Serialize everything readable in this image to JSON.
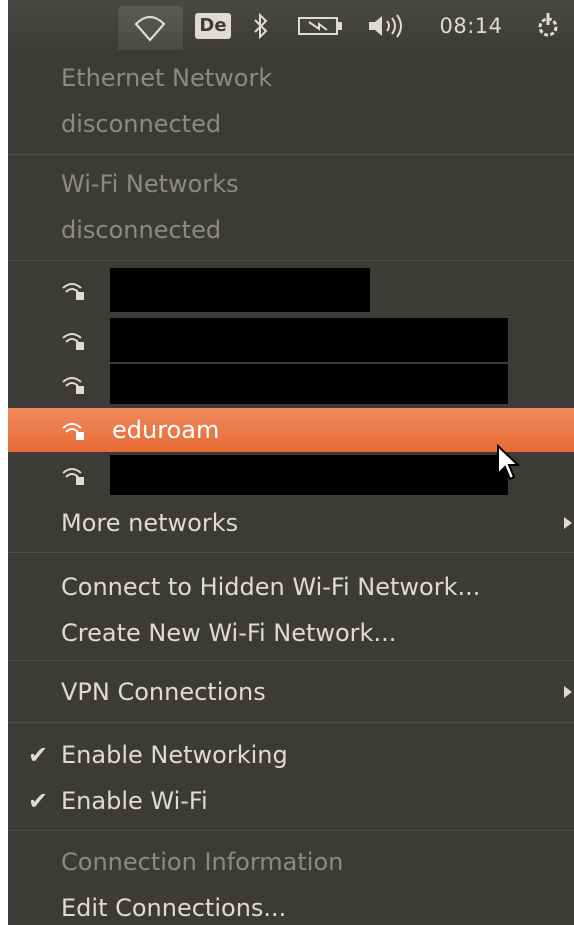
{
  "topbar": {
    "keyboard_layout": "De",
    "time": "08:14",
    "icons": [
      "wifi-icon",
      "bluetooth-icon",
      "battery-charging-icon",
      "volume-icon",
      "power-gear-icon"
    ]
  },
  "menu": {
    "ethernet_header": "Ethernet Network",
    "ethernet_status": "disconnected",
    "wifi_header": "Wi-Fi Networks",
    "wifi_status": "disconnected",
    "networks": [
      {
        "name": "",
        "redacted": true
      },
      {
        "name": "",
        "redacted": true
      },
      {
        "name": "",
        "redacted": true
      },
      {
        "name": "eduroam",
        "redacted": false,
        "highlighted": true
      },
      {
        "name": "",
        "redacted": true
      }
    ],
    "more_networks": "More networks",
    "connect_hidden": "Connect to Hidden Wi-Fi Network...",
    "create_new": "Create New Wi-Fi Network...",
    "vpn": "VPN Connections",
    "enable_networking": "Enable Networking",
    "enable_wifi": "Enable Wi-Fi",
    "connection_info": "Connection Information",
    "edit_connections": "Edit Connections...",
    "check_mark": "✔"
  },
  "colors": {
    "panel_bg": "#3c3b37",
    "text": "#dfdbd2",
    "disabled_text": "#8d8a83",
    "highlight": "#e9703e"
  }
}
